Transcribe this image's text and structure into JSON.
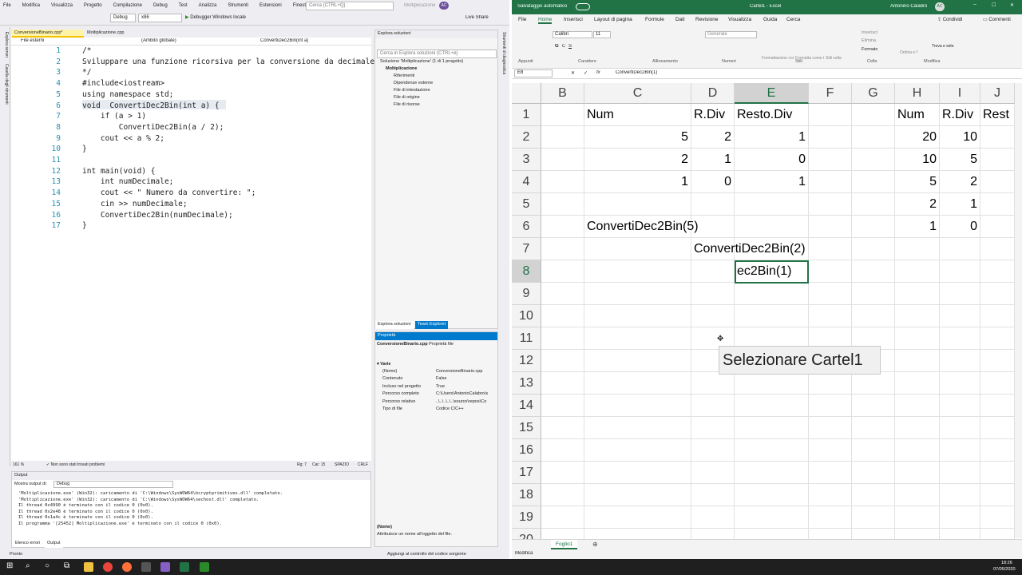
{
  "vs": {
    "menu": [
      "File",
      "Modifica",
      "Visualizza",
      "Progetto",
      "Compilazione",
      "Debug",
      "Test",
      "Analizza",
      "Strumenti",
      "Estensioni",
      "Finestra",
      "?"
    ],
    "search_placeholder": "Cerca (CTRL+Q)",
    "project_name": "Moltiplicazione",
    "user_initials": "AC",
    "live_share": "Live Share",
    "config": "Debug",
    "platform": "x86",
    "debugger": "Debugger Windows locale",
    "tabs": [
      "ConversioneBinario.cpp*",
      "Moltiplicazione.cpp"
    ],
    "nav": [
      "File esterni",
      "(Ambito globale)",
      "ConvertiDec2Bin(int a)"
    ],
    "side_labels": [
      "Esplora server",
      "Casella degli strumenti"
    ],
    "right_side_label": "Strumenti di diagnostica",
    "code": [
      {
        "n": "1",
        "t": "/*"
      },
      {
        "n": "2",
        "t": "Sviluppare una funzione ricorsiva per la conversione da decimale a binario"
      },
      {
        "n": "3",
        "t": "*/"
      },
      {
        "n": "4",
        "t": "#include<iostream>"
      },
      {
        "n": "5",
        "t": "using namespace std;"
      },
      {
        "n": "6",
        "t": "void  ConvertiDec2Bin(int a) {"
      },
      {
        "n": "7",
        "t": "    if (a > 1)"
      },
      {
        "n": "8",
        "t": "        ConvertiDec2Bin(a / 2);"
      },
      {
        "n": "9",
        "t": "    cout << a % 2;"
      },
      {
        "n": "10",
        "t": "}"
      },
      {
        "n": "11",
        "t": ""
      },
      {
        "n": "12",
        "t": "int main(void) {"
      },
      {
        "n": "13",
        "t": "    int numDecimale;"
      },
      {
        "n": "14",
        "t": "    cout << \" Numero da convertire: \";"
      },
      {
        "n": "15",
        "t": "    cin >> numDecimale;"
      },
      {
        "n": "16",
        "t": "    ConvertiDec2Bin(numDecimale);"
      },
      {
        "n": "17",
        "t": "}"
      }
    ],
    "editor_status": {
      "zoom": "161 %",
      "issues": "Non sono stati trovati problemi",
      "pos": "Rg: 7",
      "col": "Car: 15",
      "ws": "SPAZIO",
      "eol": "CRLF"
    },
    "solution": {
      "title": "Esplora soluzioni",
      "search": "Cerca in Esplora soluzioni (CTRL+è)",
      "items": [
        "Soluzione 'Moltiplicazione' (1 di 1 progetto)",
        "Moltiplicazione",
        "Riferimenti",
        "Dipendenze esterne",
        "File di intestazione",
        "File di origine",
        "File di risorse"
      ],
      "bottom_tabs": [
        "Esplora soluzioni",
        "Team Explorer"
      ]
    },
    "properties": {
      "title": "Proprietà",
      "object": "ConversioneBinario.cpp",
      "object_type": "Proprietà file",
      "section": "Varie",
      "rows": [
        [
          "(Nome)",
          "ConversioneBinario.cpp"
        ],
        [
          "Contenuto",
          "False"
        ],
        [
          "Incluso nel progetto",
          "True"
        ],
        [
          "Percorso completo",
          "C:\\Users\\AntonioCalabro\\s"
        ],
        [
          "Percorso relativo",
          "..\\..\\..\\..\\..\\source\\repos\\Co"
        ],
        [
          "Tipo di file",
          "Codice C/C++"
        ]
      ],
      "desc_title": "(Nome)",
      "desc": "Attribuisce un nome all'oggetto del file."
    },
    "output": {
      "title": "Output",
      "show_label": "Mostra output di:",
      "source": "Debug",
      "lines": [
        "'Moltiplicazione.exe' (Win32): caricamento di 'C:\\Windows\\SysWOW64\\bcryptprimitives.dll' completato.",
        "'Moltiplicazione.exe' (Win32): caricamento di 'C:\\Windows\\SysWOW64\\sechost.dll' completato.",
        "Il thread 0x4990 è terminato con il codice 0 (0x0).",
        "Il thread 0x2e48 è terminato con il codice 0 (0x0).",
        "Il thread 0x1a4c è terminato con il codice 0 (0x0).",
        "Il programma '[25452] Moltiplicazione.exe' è terminato con il codice 0 (0x0)."
      ],
      "tabs": [
        "Elenco errori",
        "Output"
      ]
    },
    "status": {
      "ready": "Pronto",
      "source_control": "Aggiungi al controllo del codice sorgente"
    }
  },
  "excel": {
    "autosave": "Salvataggio automatico",
    "title": "Cartel1 - Excel",
    "user": "Antonino Calabrò",
    "user_initials": "AC",
    "ribbon_tabs": [
      "File",
      "Home",
      "Inserisci",
      "Layout di pagina",
      "Formule",
      "Dati",
      "Revisione",
      "Visualizza",
      "Guida",
      "Cerca"
    ],
    "share": "Condividi",
    "comments": "Commenti",
    "groups": [
      "Appunti",
      "Carattere",
      "Allineamento",
      "Numeri",
      "Stili",
      "Celle",
      "Modifica"
    ],
    "font": "Calibri",
    "font_size": "11",
    "number_format": "Generale",
    "style_buttons": [
      "Formattazione condizionale",
      "Formatta come tabella",
      "Stili cella"
    ],
    "cell_buttons": [
      "Inserisci",
      "Elimina",
      "Formato"
    ],
    "edit_buttons": [
      "Ordina e filtra",
      "Trova e seleziona"
    ],
    "name_box": "E8",
    "formula": "ConvertiDec2Bin(1)",
    "columns": [
      "B",
      "C",
      "D",
      "E",
      "F",
      "G",
      "H",
      "I",
      "J"
    ],
    "rows": [
      "1",
      "2",
      "3",
      "4",
      "5",
      "6",
      "7",
      "8",
      "9",
      "10",
      "11",
      "12",
      "13",
      "14",
      "15",
      "16",
      "17",
      "18",
      "19",
      "20"
    ],
    "cells": [
      {
        "c": "C",
        "r": 1,
        "v": "Num",
        "a": "left"
      },
      {
        "c": "D",
        "r": 1,
        "v": "R.Div",
        "a": "left"
      },
      {
        "c": "E",
        "r": 1,
        "v": "Resto.Div",
        "a": "left"
      },
      {
        "c": "C",
        "r": 2,
        "v": "5",
        "a": "right"
      },
      {
        "c": "D",
        "r": 2,
        "v": "2",
        "a": "right"
      },
      {
        "c": "E",
        "r": 2,
        "v": "1",
        "a": "right"
      },
      {
        "c": "C",
        "r": 3,
        "v": "2",
        "a": "right"
      },
      {
        "c": "D",
        "r": 3,
        "v": "1",
        "a": "right"
      },
      {
        "c": "E",
        "r": 3,
        "v": "0",
        "a": "right"
      },
      {
        "c": "C",
        "r": 4,
        "v": "1",
        "a": "right"
      },
      {
        "c": "D",
        "r": 4,
        "v": "0",
        "a": "right"
      },
      {
        "c": "E",
        "r": 4,
        "v": "1",
        "a": "right"
      },
      {
        "c": "C",
        "r": 6,
        "v": "ConvertiDec2Bin(5)",
        "a": "left"
      },
      {
        "c": "D",
        "r": 7,
        "v": "ConvertiDec2Bin(2)",
        "a": "left"
      },
      {
        "c": "E",
        "r": 8,
        "v": "ec2Bin(1)",
        "a": "left"
      },
      {
        "c": "H",
        "r": 1,
        "v": "Num",
        "a": "left"
      },
      {
        "c": "I",
        "r": 1,
        "v": "R.Div",
        "a": "left"
      },
      {
        "c": "J",
        "r": 1,
        "v": "Rest",
        "a": "left"
      },
      {
        "c": "H",
        "r": 2,
        "v": "20",
        "a": "right"
      },
      {
        "c": "I",
        "r": 2,
        "v": "10",
        "a": "right"
      },
      {
        "c": "H",
        "r": 3,
        "v": "10",
        "a": "right"
      },
      {
        "c": "I",
        "r": 3,
        "v": "5",
        "a": "right"
      },
      {
        "c": "H",
        "r": 4,
        "v": "5",
        "a": "right"
      },
      {
        "c": "I",
        "r": 4,
        "v": "2",
        "a": "right"
      },
      {
        "c": "H",
        "r": 5,
        "v": "2",
        "a": "right"
      },
      {
        "c": "I",
        "r": 5,
        "v": "1",
        "a": "right"
      },
      {
        "c": "H",
        "r": 6,
        "v": "1",
        "a": "right"
      },
      {
        "c": "I",
        "r": 6,
        "v": "0",
        "a": "right"
      }
    ],
    "tooltip": "Selezionare Cartel1",
    "sheet_tab": "Foglio1",
    "status": "Modifica"
  },
  "taskbar": {
    "time": "18:26",
    "date": "07/05/2020"
  }
}
